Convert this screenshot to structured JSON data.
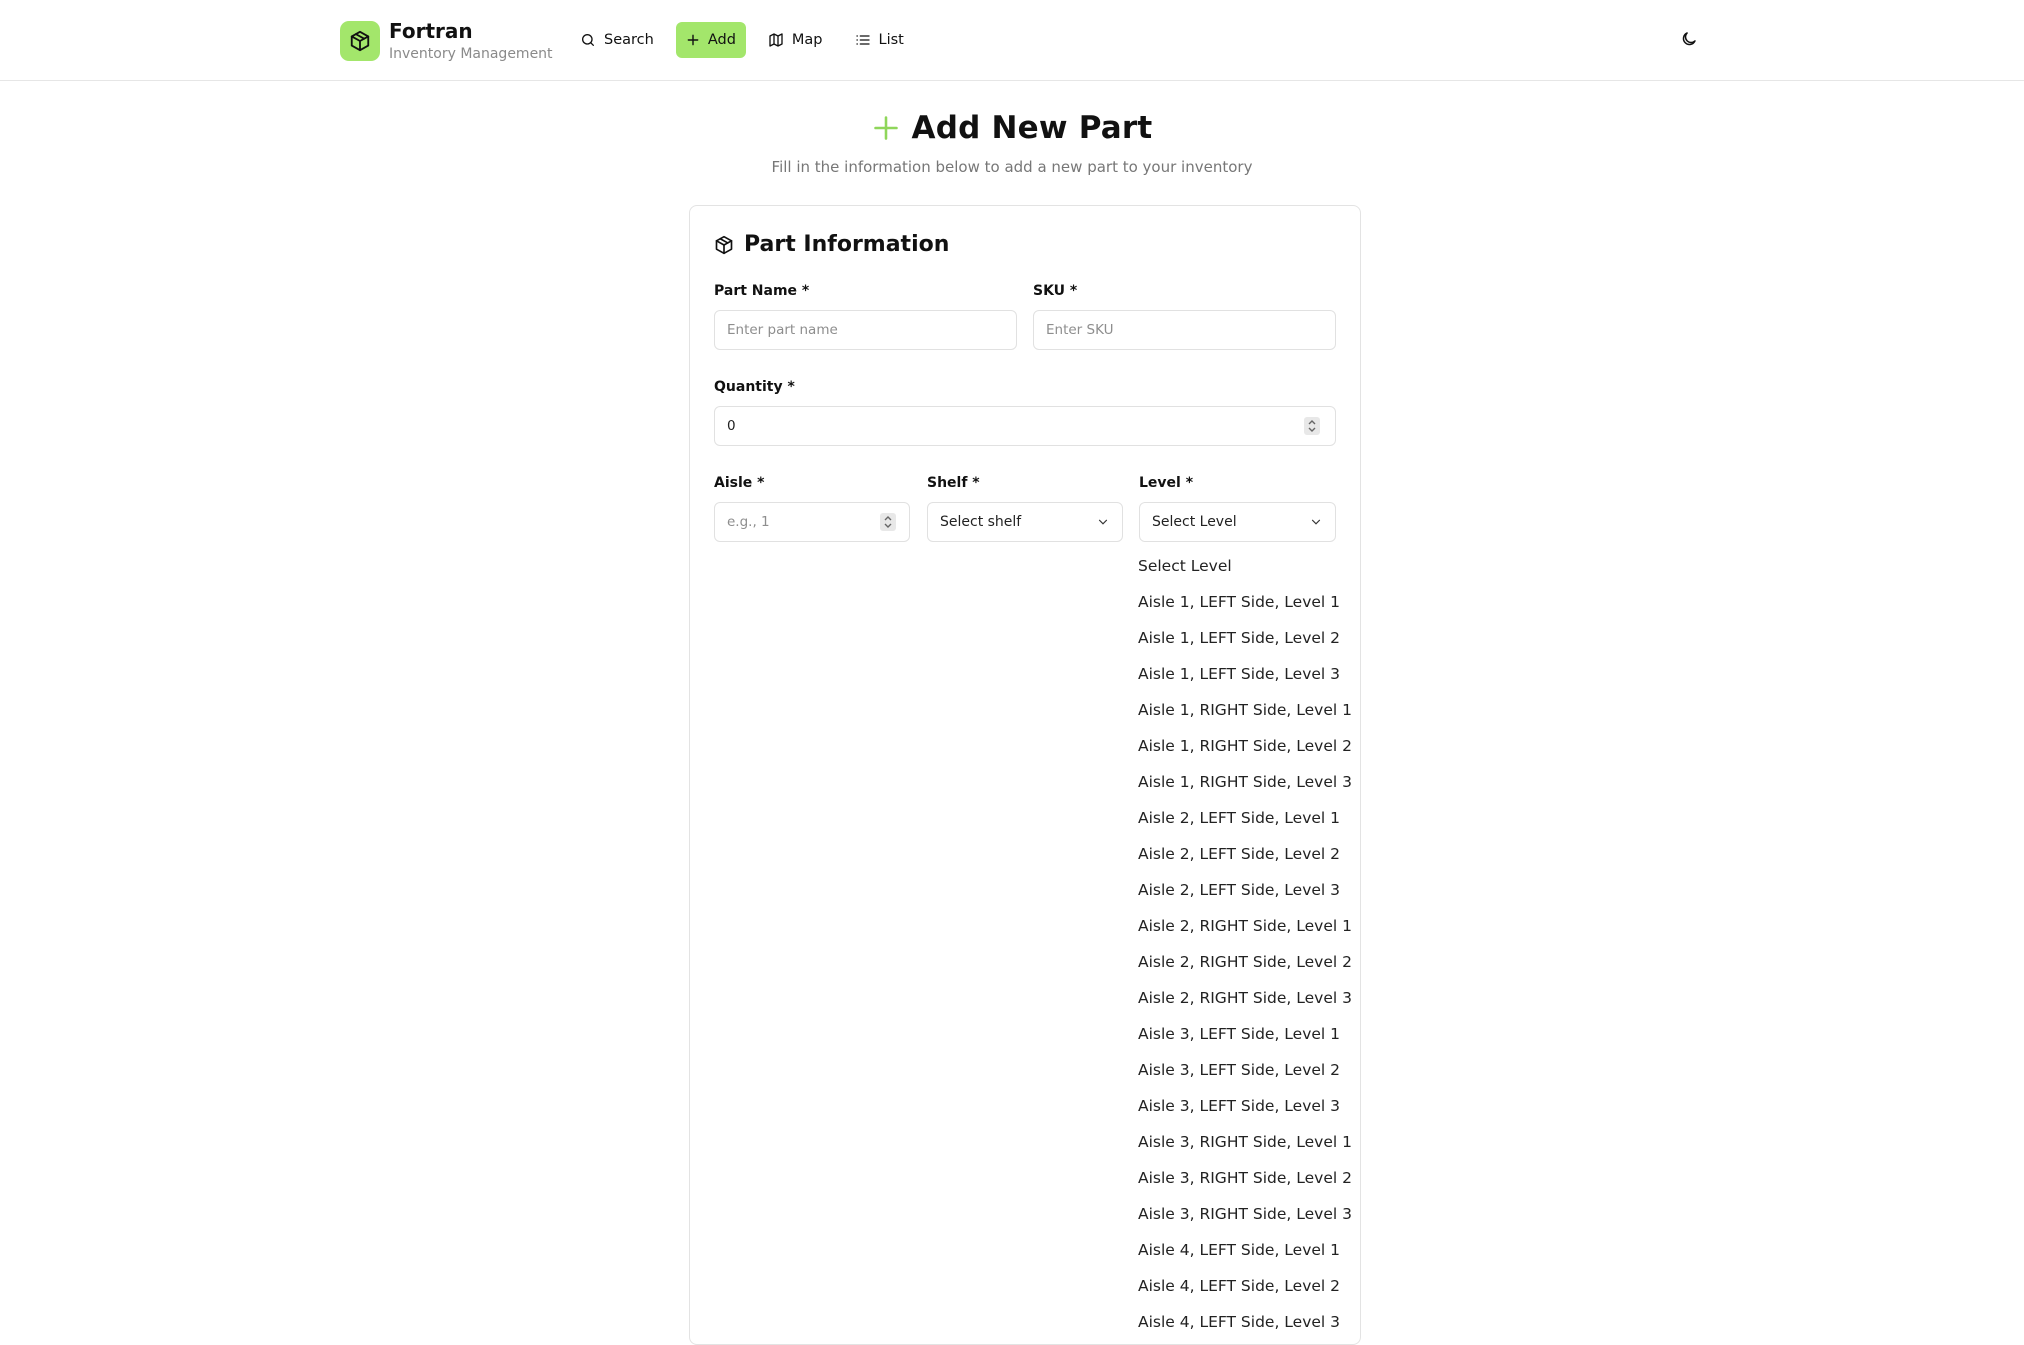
{
  "header": {
    "brand_title": "Fortran",
    "brand_subtitle": "Inventory Management",
    "nav": {
      "search": "Search",
      "add": "Add",
      "map": "Map",
      "list": "List"
    }
  },
  "page": {
    "title": "Add New Part",
    "subtitle": "Fill in the information below to add a new part to your inventory"
  },
  "form": {
    "section_title": "Part Information",
    "part_name": {
      "label": "Part Name *",
      "placeholder": "Enter part name"
    },
    "sku": {
      "label": "SKU *",
      "placeholder": "Enter SKU"
    },
    "quantity": {
      "label": "Quantity *",
      "value": "0"
    },
    "aisle": {
      "label": "Aisle *",
      "placeholder": "e.g., 1"
    },
    "shelf": {
      "label": "Shelf *",
      "value": "Select shelf"
    },
    "level": {
      "label": "Level *",
      "value": "Select Level"
    }
  },
  "level_options": [
    "Select Level",
    "Aisle 1, LEFT Side, Level 1",
    "Aisle 1, LEFT Side, Level 2",
    "Aisle 1, LEFT Side, Level 3",
    "Aisle 1, RIGHT Side, Level 1",
    "Aisle 1, RIGHT Side, Level 2",
    "Aisle 1, RIGHT Side, Level 3",
    "Aisle 2, LEFT Side, Level 1",
    "Aisle 2, LEFT Side, Level 2",
    "Aisle 2, LEFT Side, Level 3",
    "Aisle 2, RIGHT Side, Level 1",
    "Aisle 2, RIGHT Side, Level 2",
    "Aisle 2, RIGHT Side, Level 3",
    "Aisle 3, LEFT Side, Level 1",
    "Aisle 3, LEFT Side, Level 2",
    "Aisle 3, LEFT Side, Level 3",
    "Aisle 3, RIGHT Side, Level 1",
    "Aisle 3, RIGHT Side, Level 2",
    "Aisle 3, RIGHT Side, Level 3",
    "Aisle 4, LEFT Side, Level 1",
    "Aisle 4, LEFT Side, Level 2",
    "Aisle 4, LEFT Side, Level 3"
  ],
  "colors": {
    "accent": "#a3e66b",
    "accent_icon": "#8fd65a"
  },
  "icons": {
    "brand": "package-icon",
    "search": "search-icon",
    "add": "plus-icon",
    "map": "map-icon",
    "list": "list-icon",
    "theme": "moon-icon"
  }
}
